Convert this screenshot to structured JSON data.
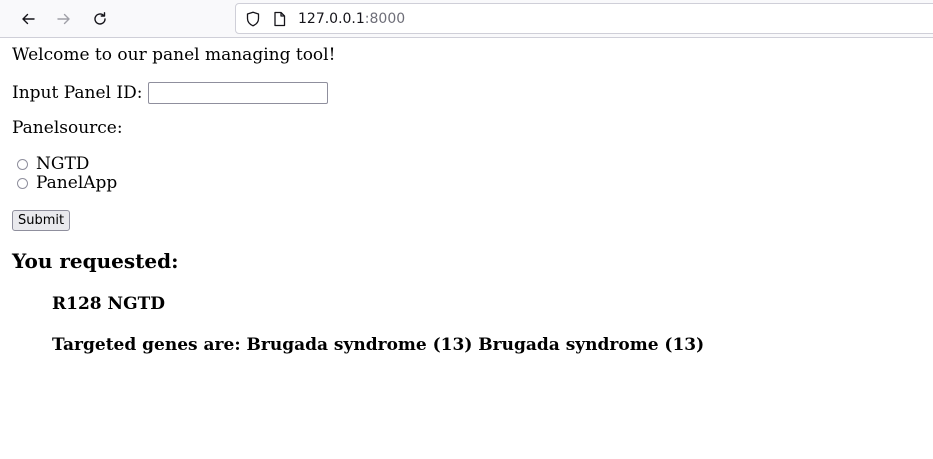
{
  "browser": {
    "url_host": "127.0.0.1",
    "url_port": ":8000",
    "icons": [
      "back-arrow-icon",
      "forward-arrow-icon",
      "reload-icon",
      "shield-icon",
      "page-icon"
    ]
  },
  "page": {
    "welcome": "Welcome to our panel managing tool!",
    "input_label": "Input Panel ID:",
    "input_value": "",
    "panelsource_label": "Panelsource:",
    "radio_options": [
      "NGTD",
      "PanelApp"
    ],
    "submit_label": "Submit",
    "result_heading": "You requested:",
    "result_id": "R128 NGTD",
    "result_genes": "Targeted genes are: Brugada syndrome (13) Brugada syndrome (13)"
  }
}
